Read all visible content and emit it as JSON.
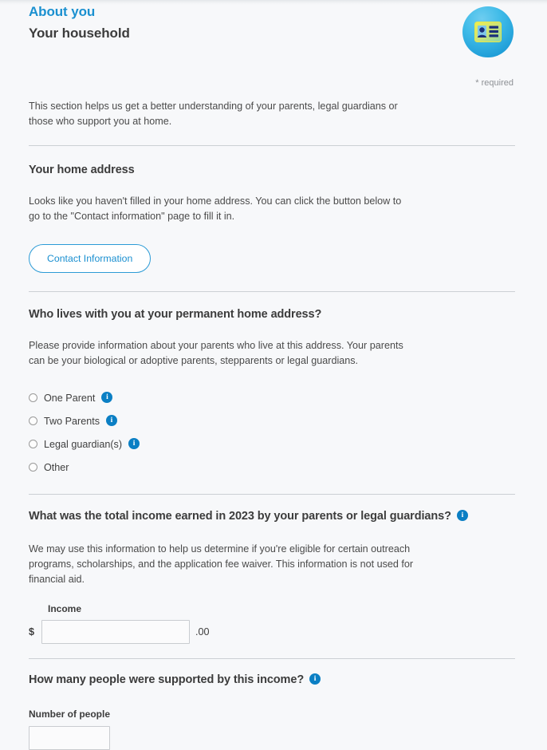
{
  "header": {
    "eyebrow": "About you",
    "title": "Your household",
    "badge_icon": "id-card-icon",
    "required_note": "* required"
  },
  "intro": {
    "text": "This section helps us get a better understanding of your parents, legal guardians or those who support you at home."
  },
  "home_address": {
    "heading": "Your home address",
    "text": "Looks like you haven't filled in your home address. You can click the button below to go to the \"Contact information\" page to fill it in.",
    "button_label": "Contact Information"
  },
  "who_lives": {
    "heading": "Who lives with you at your permanent home address?",
    "help_text": "Please provide information about your parents who live at this address. Your parents can be your biological or adoptive parents, stepparents or legal guardians.",
    "options": [
      {
        "label": "One Parent",
        "has_info": true,
        "selected": false
      },
      {
        "label": "Two Parents",
        "has_info": true,
        "selected": false
      },
      {
        "label": "Legal guardian(s)",
        "has_info": true,
        "selected": false
      },
      {
        "label": "Other",
        "has_info": false,
        "selected": false
      }
    ]
  },
  "income": {
    "heading": "What was the total income earned in 2023 by your parents or legal guardians?",
    "has_info": true,
    "help_text": "We may use this information to help us determine if you're eligible for certain outreach programs, scholarships, and the application fee waiver. This information is not used for financial aid.",
    "field_label": "Income",
    "currency_symbol": "$",
    "decimal_suffix": ".00",
    "value": "",
    "placeholder": ""
  },
  "supported_people": {
    "heading": "How many people were supported by this income?",
    "has_info": true,
    "field_label": "Number of people",
    "value": "",
    "placeholder": ""
  },
  "icons": {
    "info_glyph": "i"
  },
  "colors": {
    "accent_blue": "#1a90d0",
    "info_blue": "#0b7fc4",
    "heading_gray": "#3c3c3c",
    "page_background": "#f7f8fa",
    "divider": "#ccd0d4"
  }
}
